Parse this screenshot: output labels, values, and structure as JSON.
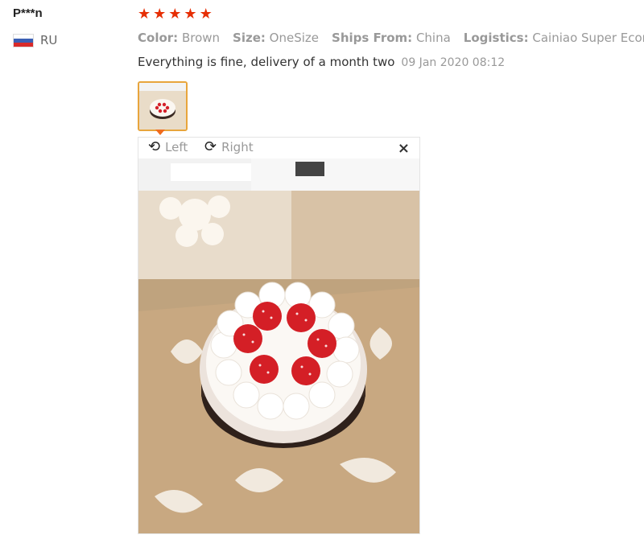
{
  "reviewer": {
    "name": "P***n",
    "country": "RU",
    "rating": 5
  },
  "attributes": [
    {
      "key": "Color:",
      "value": "Brown"
    },
    {
      "key": "Size:",
      "value": "OneSize"
    },
    {
      "key": "Ships From:",
      "value": "China"
    },
    {
      "key": "Logistics:",
      "value": "Cainiao Super Econom"
    }
  ],
  "feedback": {
    "text": "Everything is fine, delivery of a month two",
    "date": "09 Jan 2020 08:12"
  },
  "viewer": {
    "rotate_left": "Left",
    "rotate_right": "Right",
    "close": "×"
  },
  "colors": {
    "star": "#e62e04",
    "thumb_border": "#e8a53c",
    "pointer": "#f06c1f"
  }
}
